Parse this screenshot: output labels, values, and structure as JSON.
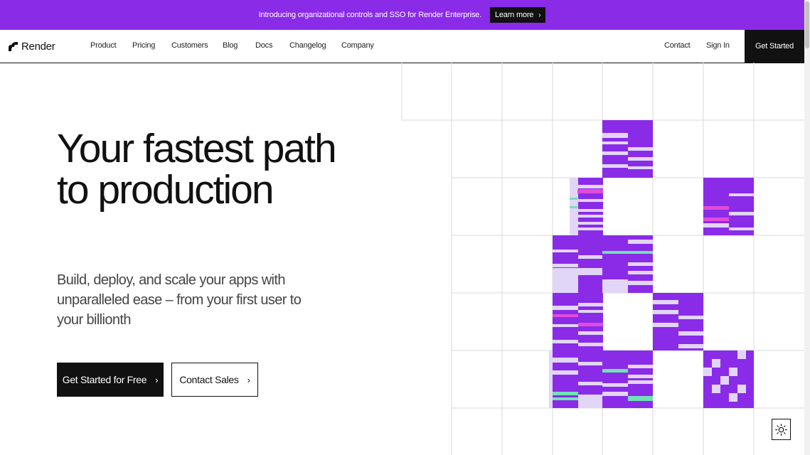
{
  "announcement": {
    "text": "Introducing organizational controls and SSO for Render Enterprise.",
    "cta_label": "Learn more"
  },
  "nav": {
    "brand": "Render",
    "links": [
      "Product",
      "Pricing",
      "Customers",
      "Blog",
      "Docs",
      "Changelog",
      "Company"
    ],
    "contact": "Contact",
    "sign_in": "Sign In",
    "get_started": "Get Started"
  },
  "hero": {
    "title": "Your fastest path to production",
    "subtitle": "Build, deploy, and scale your apps with unparalleled ease – from your first user to your billionth",
    "primary_cta": "Get Started for Free",
    "secondary_cta": "Contact Sales"
  },
  "colors": {
    "brand_purple": "#8a2be8",
    "lavender": "#e2d6f8",
    "pink": "#e24bdc",
    "mint": "#6fe3b4",
    "black": "#111111"
  },
  "icons": {
    "logo": "render-logo-icon",
    "chevron": "chevron-right-icon",
    "theme": "sun-icon"
  }
}
